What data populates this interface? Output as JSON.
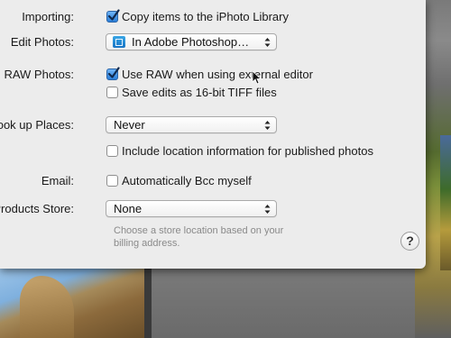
{
  "importing": {
    "label": "Importing:",
    "copy_items": "Copy items to the iPhoto Library",
    "checked": true
  },
  "edit_photos": {
    "label": "Edit Photos:",
    "value": "In Adobe Photoshop…"
  },
  "raw_photos": {
    "label": "RAW Photos:",
    "use_raw": "Use RAW when using external editor",
    "use_raw_checked": true,
    "save_tiff": "Save edits as 16-bit TIFF files",
    "save_tiff_checked": false
  },
  "look_up_places": {
    "label": "Look up Places:",
    "value": "Never"
  },
  "location_info": {
    "text": "Include location information for published photos",
    "checked": false
  },
  "email": {
    "label": "Email:",
    "auto_bcc": "Automatically Bcc myself",
    "checked": false
  },
  "products_store": {
    "label": "nt Products Store:",
    "value": "None",
    "hint_line1": "Choose a store location based on your",
    "hint_line2": "billing address."
  },
  "help": {
    "glyph": "?"
  },
  "colors": {
    "panel": "#ececec",
    "accent": "#2b7fd9"
  }
}
